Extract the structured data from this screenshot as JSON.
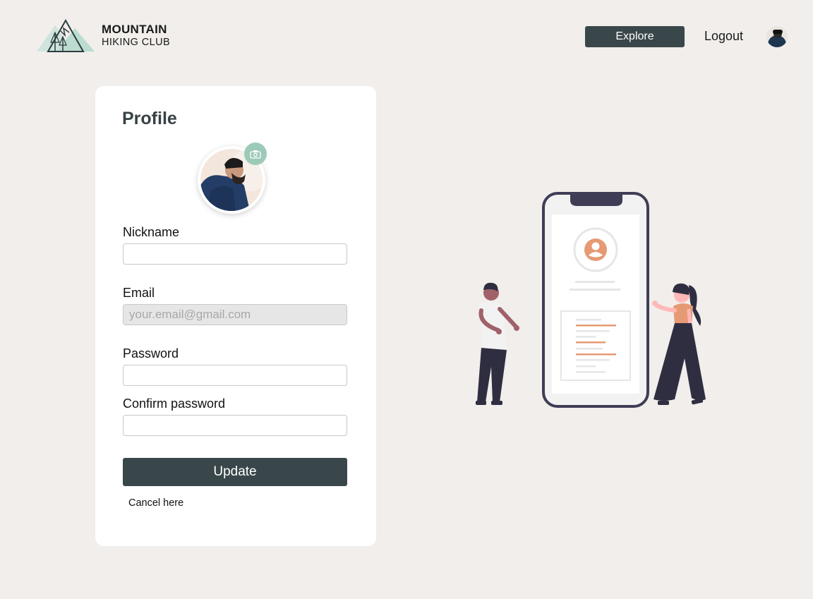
{
  "brand": {
    "line1": "MOUNTAIN",
    "line2": "HIKING CLUB"
  },
  "nav": {
    "explore_label": "Explore",
    "logout_label": "Logout"
  },
  "profile": {
    "title": "Profile",
    "nickname": {
      "label": "Nickname",
      "value": "",
      "placeholder": ""
    },
    "email": {
      "label": "Email",
      "value": "",
      "placeholder": "your.email@gmail.com"
    },
    "password": {
      "label": "Password",
      "value": "",
      "placeholder": ""
    },
    "confirm_password": {
      "label": "Confirm password",
      "value": "",
      "placeholder": ""
    },
    "update_label": "Update",
    "cancel_label": "Cancel here"
  },
  "colors": {
    "background": "#f1eeeb",
    "primary_button": "#3a474a",
    "title_text": "#364245",
    "accent_mint": "#9ccab9",
    "illustration_accent": "#e59a74",
    "illustration_dark": "#3f3d56"
  },
  "icons": {
    "camera": "camera-icon",
    "logo": "mountain-logo-icon"
  }
}
